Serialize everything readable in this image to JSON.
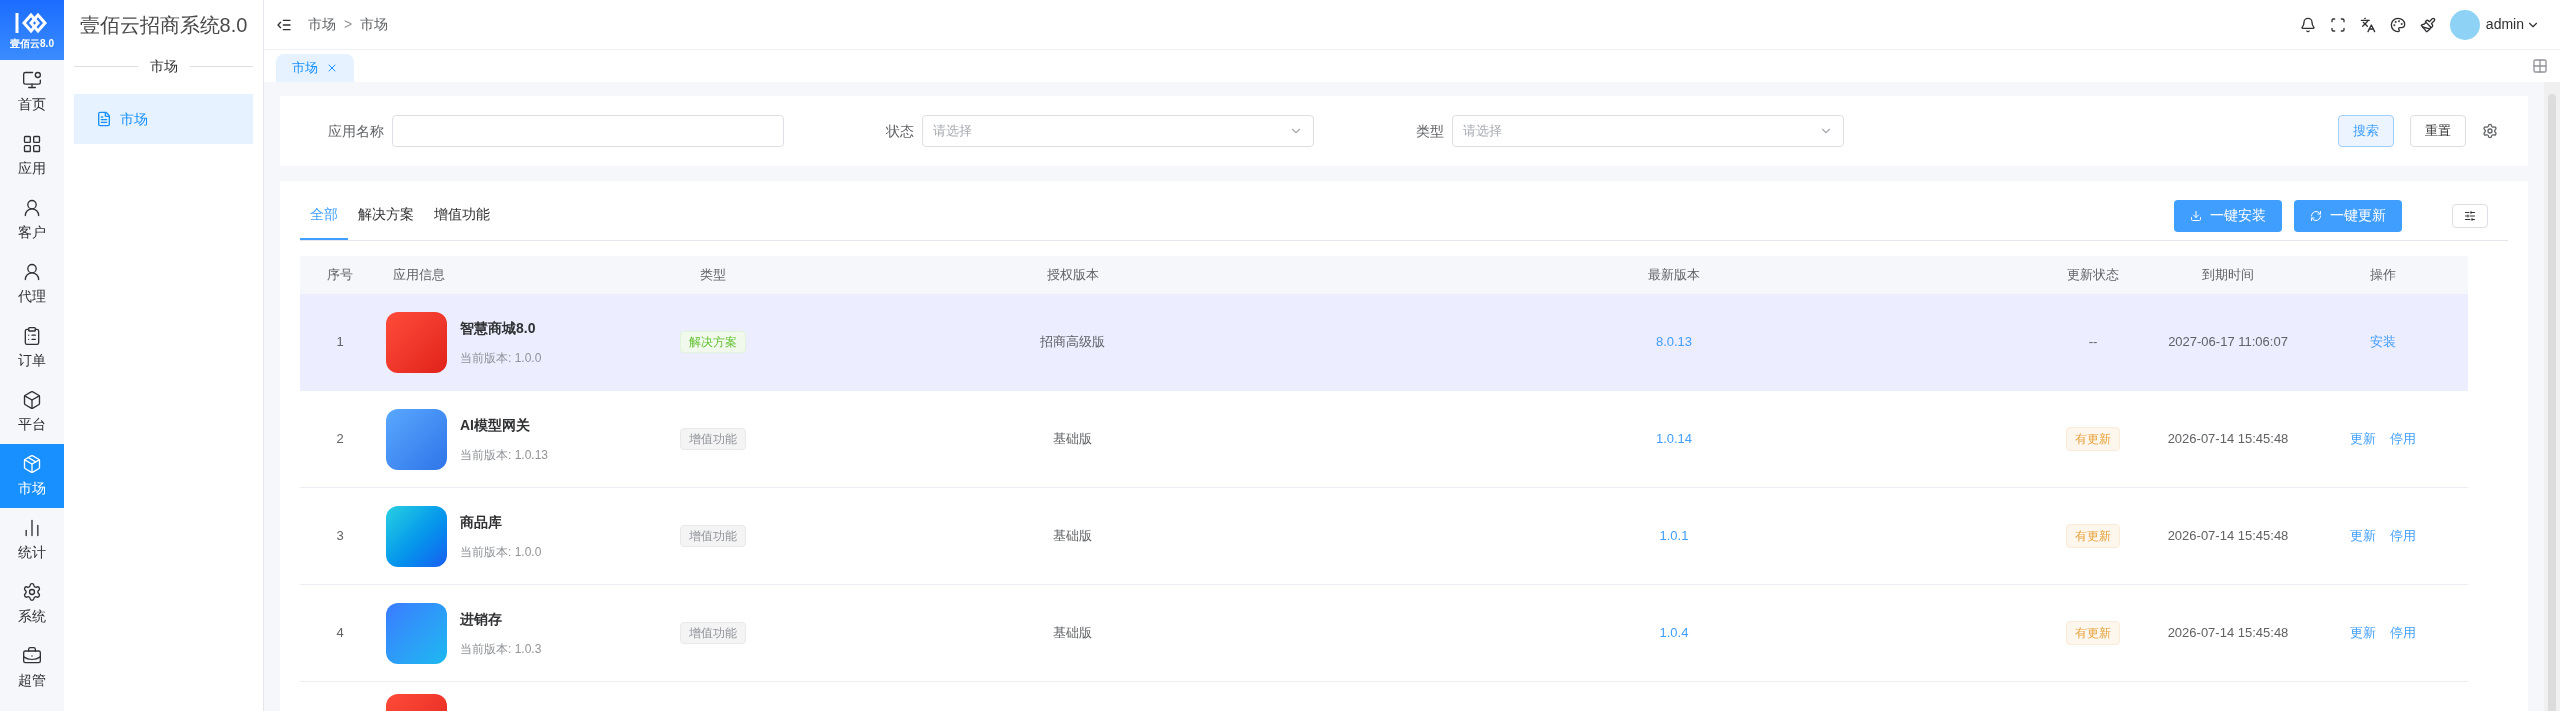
{
  "brand": {
    "logo_text": "壹佰云8.0",
    "title": "壹佰云招商系统8.0"
  },
  "nav": [
    {
      "label": "首页",
      "selected": false
    },
    {
      "label": "应用",
      "selected": false
    },
    {
      "label": "客户",
      "selected": false
    },
    {
      "label": "代理",
      "selected": false
    },
    {
      "label": "订单",
      "selected": false
    },
    {
      "label": "平台",
      "selected": false
    },
    {
      "label": "市场",
      "selected": true
    },
    {
      "label": "统计",
      "selected": false
    },
    {
      "label": "系统",
      "selected": false
    },
    {
      "label": "超管",
      "selected": false
    }
  ],
  "submenu": {
    "heading": "市场",
    "items": [
      {
        "label": "市场",
        "selected": true
      }
    ]
  },
  "header": {
    "breadcrumb": [
      "市场",
      "市场"
    ],
    "separator": ">",
    "user": "admin"
  },
  "page_tabs": [
    {
      "label": "市场",
      "selected": true
    }
  ],
  "filters": [
    {
      "label": "应用名称",
      "kind": "text"
    },
    {
      "label": "状态",
      "kind": "select",
      "placeholder": "请选择"
    },
    {
      "label": "类型",
      "kind": "select",
      "placeholder": "请选择"
    }
  ],
  "filter_buttons": [
    {
      "label": "搜索",
      "kind": "primary"
    },
    {
      "label": "重置",
      "kind": "default"
    }
  ],
  "category_tabs": [
    {
      "label": "全部",
      "selected": true
    },
    {
      "label": "解决方案",
      "selected": false
    },
    {
      "label": "增值功能",
      "selected": false
    }
  ],
  "actions": [
    {
      "label": "一键安装",
      "kind": "install"
    },
    {
      "label": "一键更新",
      "kind": "update"
    }
  ],
  "table": {
    "columns": [
      "序号",
      "应用信息",
      "类型",
      "授权版本",
      "最新版本",
      "更新状态",
      "到期时间",
      "操作"
    ],
    "rows": [
      {
        "index": "1",
        "name": "智慧商城8.0",
        "current_version": "当前版本: 1.0.0",
        "type": {
          "label": "解决方案",
          "kind": "solution"
        },
        "license": "招商高级版",
        "latest": "8.0.13",
        "update_status": {
          "label": "--",
          "kind": "none"
        },
        "expiry": "2027-06-17 11:06:07",
        "operations": [
          "安装"
        ],
        "highlighted": true
      },
      {
        "index": "2",
        "name": "AI模型网关",
        "current_version": "当前版本: 1.0.13",
        "type": {
          "label": "增值功能",
          "kind": "addon"
        },
        "license": "基础版",
        "latest": "1.0.14",
        "update_status": {
          "label": "有更新",
          "kind": "tag"
        },
        "expiry": "2026-07-14 15:45:48",
        "operations": [
          "更新",
          "停用"
        ],
        "highlighted": false
      },
      {
        "index": "3",
        "name": "商品库",
        "current_version": "当前版本: 1.0.0",
        "type": {
          "label": "增值功能",
          "kind": "addon"
        },
        "license": "基础版",
        "latest": "1.0.1",
        "update_status": {
          "label": "有更新",
          "kind": "tag"
        },
        "expiry": "2026-07-14 15:45:48",
        "operations": [
          "更新",
          "停用"
        ],
        "highlighted": false
      },
      {
        "index": "4",
        "name": "进销存",
        "current_version": "当前版本: 1.0.3",
        "type": {
          "label": "增值功能",
          "kind": "addon"
        },
        "license": "基础版",
        "latest": "1.0.4",
        "update_status": {
          "label": "有更新",
          "kind": "tag"
        },
        "expiry": "2026-07-14 15:45:48",
        "operations": [
          "更新",
          "停用"
        ],
        "highlighted": false
      }
    ]
  }
}
